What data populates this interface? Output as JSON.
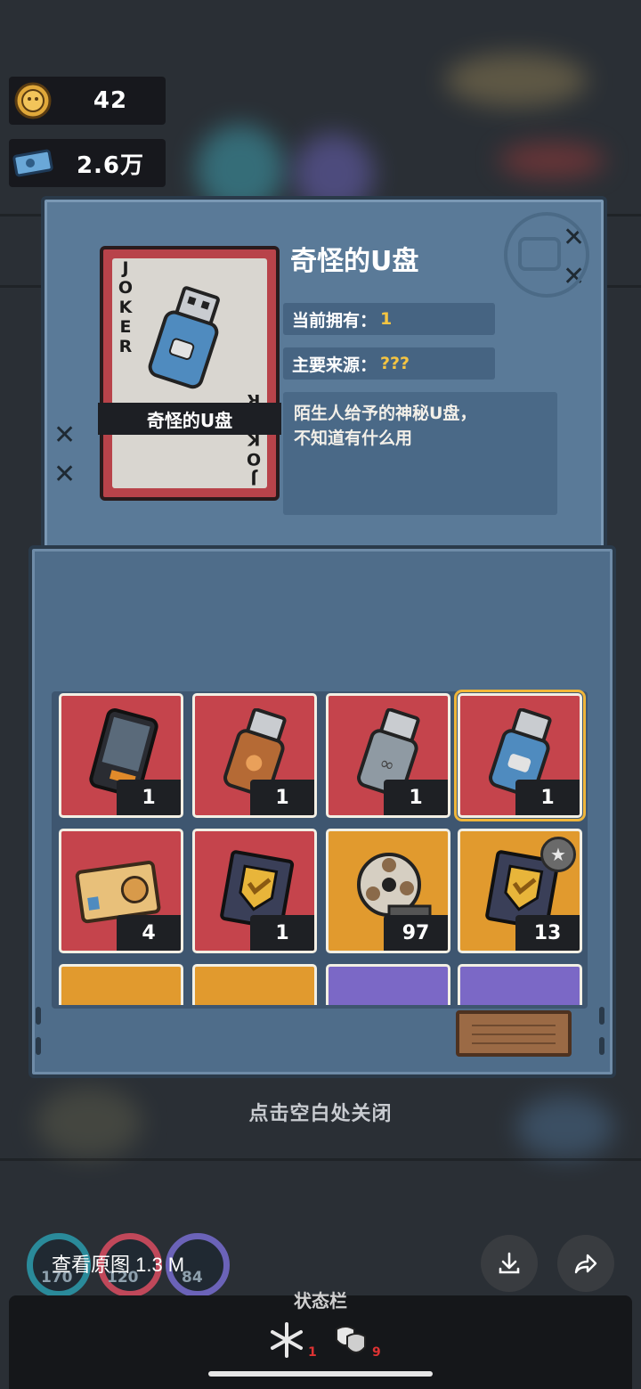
{
  "currency": {
    "coins": "42",
    "tickets": "2.6万"
  },
  "detail": {
    "title": "奇怪的U盘",
    "card_name": "奇怪的U盘",
    "joker_text": "JOKER",
    "owned_label": "当前拥有：",
    "owned_value": "1",
    "source_label": "主要来源：",
    "source_value": "???",
    "description_line1": "陌生人给予的神秘U盘，",
    "description_line2": "不知道有什么用"
  },
  "items": [
    {
      "name": "phone",
      "count": "1",
      "bg": "red"
    },
    {
      "name": "brown-usb",
      "count": "1",
      "bg": "red"
    },
    {
      "name": "grey-usb",
      "count": "1",
      "bg": "red"
    },
    {
      "name": "blue-usb",
      "count": "1",
      "bg": "red",
      "selected": true
    },
    {
      "name": "id-card",
      "count": "4",
      "bg": "red"
    },
    {
      "name": "gold-badge",
      "count": "1",
      "bg": "red"
    },
    {
      "name": "film-reel",
      "count": "97",
      "bg": "orange"
    },
    {
      "name": "star-badge",
      "count": "13",
      "bg": "orange"
    },
    {
      "name": "partial-item",
      "count": "",
      "bg": "orange"
    },
    {
      "name": "partial-item",
      "count": "",
      "bg": "orange"
    },
    {
      "name": "partial-item",
      "count": "",
      "bg": "purple"
    },
    {
      "name": "partial-item",
      "count": "",
      "bg": "purple"
    }
  ],
  "close_hint": "点击空白处关闭",
  "viewer": {
    "view_original": "查看原图 1.3 M"
  },
  "bottom": {
    "status_label": "状态栏",
    "stat1_value": "1",
    "stat2_value": "9"
  },
  "bg_rings": [
    "170",
    "120",
    "84"
  ],
  "colors": {
    "card_red": "#c5444c",
    "card_orange": "#e19a2e",
    "card_purple": "#7b68c6",
    "panel_blue": "#5a7a98",
    "highlight": "#f5c542"
  }
}
